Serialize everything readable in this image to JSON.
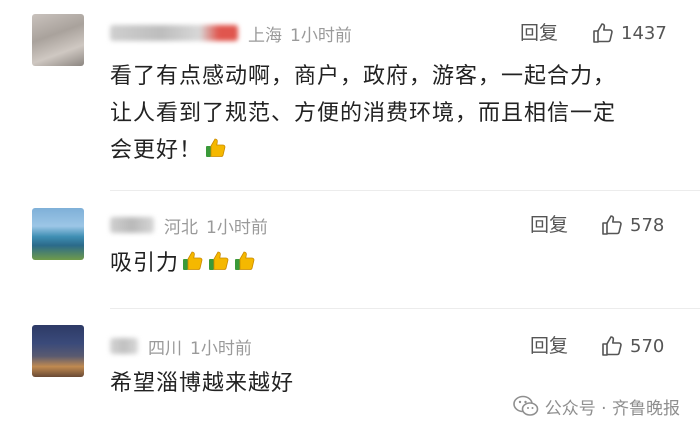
{
  "comments": [
    {
      "region": "上海",
      "time": "1小时前",
      "reply_label": "回复",
      "likes": "1437",
      "text_lines": [
        "看了有点感动啊，商户，政府，游客，一起合力，",
        "让人看到了规范、方便的消费环境，而且相信一定",
        "会更好！"
      ],
      "emoji_count": 1
    },
    {
      "region": "河北",
      "time": "1小时前",
      "reply_label": "回复",
      "likes": "578",
      "text_lines": [
        "吸引力"
      ],
      "emoji_count": 3
    },
    {
      "region": "四川",
      "time": "1小时前",
      "reply_label": "回复",
      "likes": "570",
      "text_lines": [
        "希望淄博越来越好"
      ],
      "emoji_count": 0
    }
  ],
  "footer": {
    "source": "公众号 · 齐鲁晚报"
  },
  "icons": {
    "like": "thumbs-up-outline-icon",
    "emoji": "thumbs-up-emoji-icon",
    "footer": "wechat-icon"
  },
  "colors": {
    "meta_gray": "#9a9a9a",
    "text": "#222222",
    "emoji_yellow": "#f5b800",
    "emoji_green": "#3a9a3a"
  }
}
